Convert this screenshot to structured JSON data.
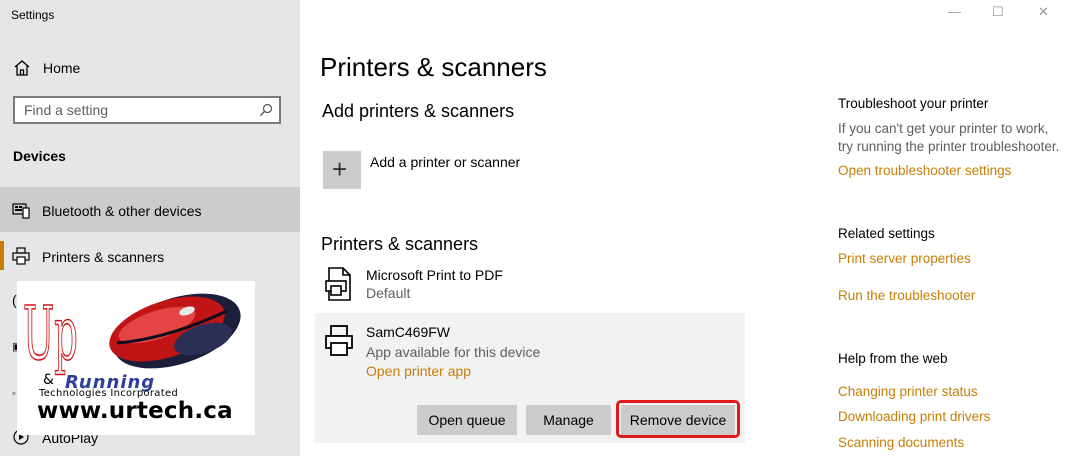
{
  "app": {
    "title": "Settings"
  },
  "window_controls": {
    "minimize": "—",
    "maximize": "☐",
    "close": "✕"
  },
  "sidebar": {
    "home_label": "Home",
    "search_placeholder": "Find a setting",
    "section": "Devices",
    "items": [
      {
        "label": "Bluetooth & other devices",
        "icon": "bluetooth-devices-icon",
        "selected": true
      },
      {
        "label": "Printers & scanners",
        "icon": "printer-icon",
        "selected": false
      },
      {
        "label": "AutoPlay",
        "icon": "autoplay-icon",
        "selected": false
      }
    ]
  },
  "watermark": {
    "letters": "Up",
    "ampersand": "&",
    "running": "Running",
    "tagline": "Technologies Incorporated",
    "url": "www.urtech.ca"
  },
  "main": {
    "title": "Printers & scanners",
    "add_section": {
      "heading": "Add printers & scanners",
      "add_label": "Add a printer or scanner"
    },
    "list_section": {
      "heading": "Printers & scanners",
      "printers": [
        {
          "name": "Microsoft Print to PDF",
          "status": "Default"
        },
        {
          "name": "SamC469FW",
          "status": "App available for this device",
          "link": "Open printer app"
        }
      ],
      "buttons": {
        "open_queue": "Open queue",
        "manage": "Manage",
        "remove": "Remove device"
      }
    }
  },
  "right": {
    "troubleshoot": {
      "heading": "Troubleshoot your printer",
      "text_line1": "If you can't get your printer to work,",
      "text_line2": "try running the printer troubleshooter.",
      "link": "Open troubleshooter settings"
    },
    "related": {
      "heading": "Related settings",
      "links": [
        "Print server properties",
        "Run the troubleshooter"
      ]
    },
    "help": {
      "heading": "Help from the web",
      "links": [
        "Changing printer status",
        "Downloading print drivers",
        "Scanning documents"
      ]
    }
  },
  "colors": {
    "accent_link": "#c77e06",
    "highlight": "#e11b1b",
    "sidebar_bg": "#e6e6e6",
    "selected_bg": "#cccccc"
  }
}
